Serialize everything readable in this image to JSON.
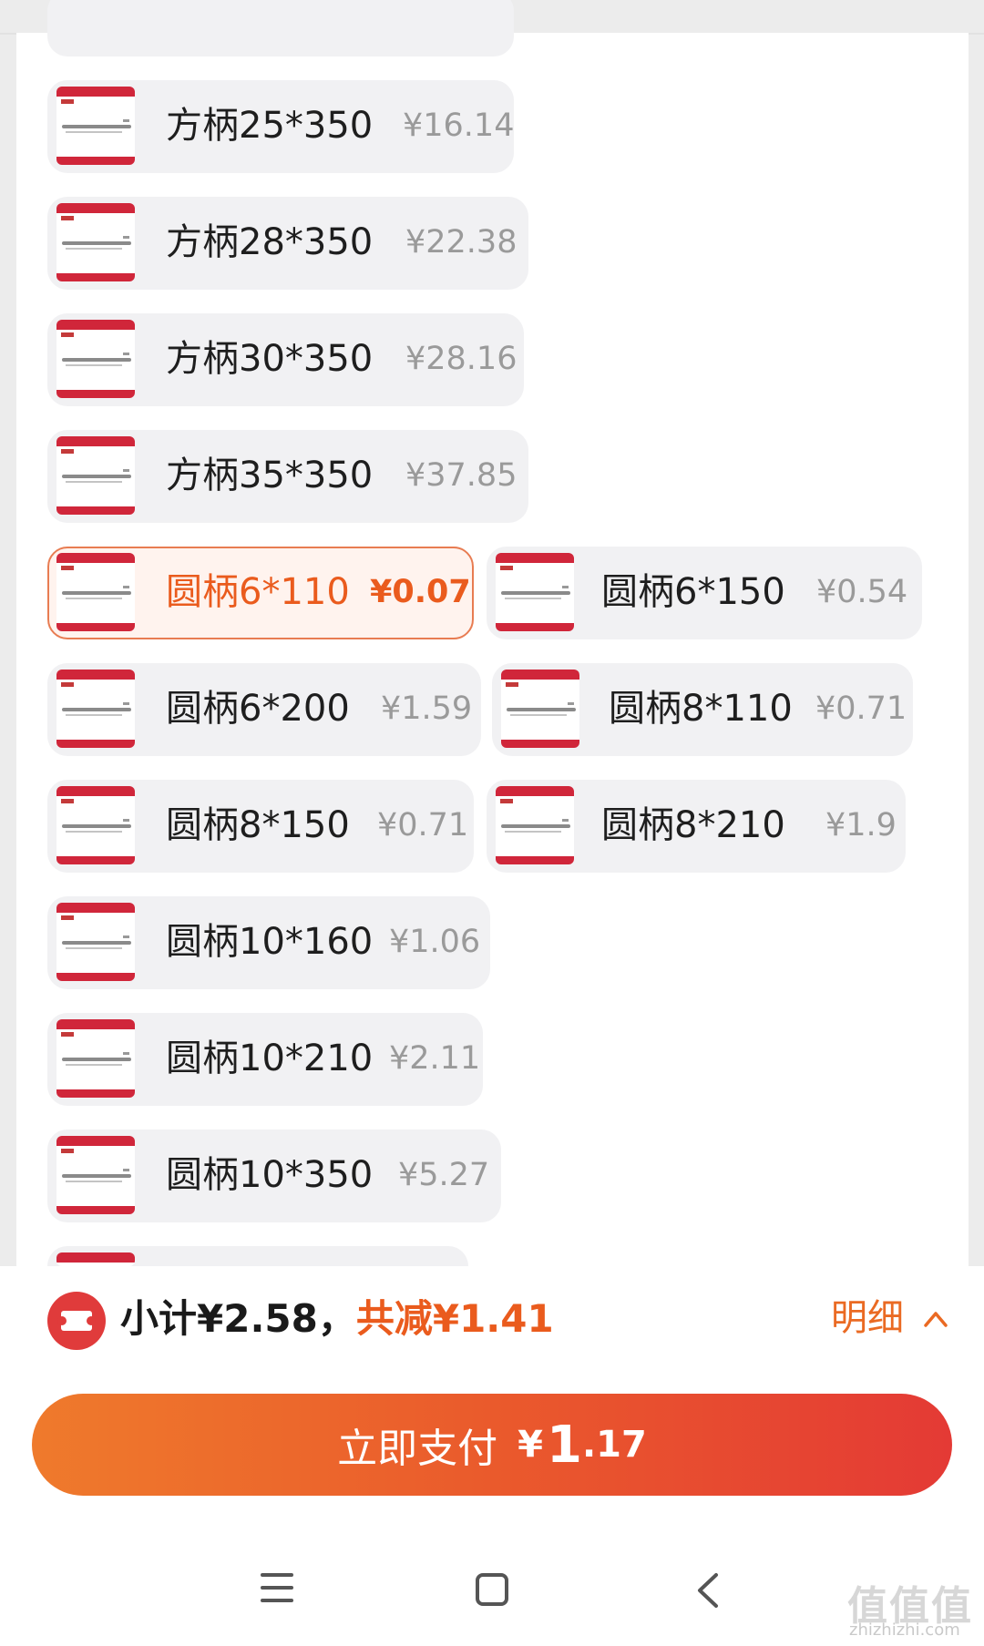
{
  "skus": [
    {
      "name": "方柄25*350",
      "price": "¥16.14"
    },
    {
      "name": "方柄28*350",
      "price": "¥22.38"
    },
    {
      "name": "方柄30*350",
      "price": "¥28.16"
    },
    {
      "name": "方柄35*350",
      "price": "¥37.85"
    },
    {
      "name": "圆柄6*110",
      "price": "¥0.07",
      "selected": true
    },
    {
      "name": "圆柄6*150",
      "price": "¥0.54"
    },
    {
      "name": "圆柄6*200",
      "price": "¥1.59"
    },
    {
      "name": "圆柄8*110",
      "price": "¥0.71"
    },
    {
      "name": "圆柄8*150",
      "price": "¥0.71"
    },
    {
      "name": "圆柄8*210",
      "price": "¥1.9"
    },
    {
      "name": "圆柄10*160",
      "price": "¥1.06"
    },
    {
      "name": "圆柄10*210",
      "price": "¥2.11"
    },
    {
      "name": "圆柄10*350",
      "price": "¥5.27"
    }
  ],
  "summary": {
    "subtotal": "小计¥2.58，",
    "discount": "共减¥1.41",
    "detail": "明细"
  },
  "pay": {
    "label": "立即支付",
    "yen": "¥",
    "integer": "1",
    "decimal": ".17"
  },
  "watermark": {
    "logo": "值值值",
    "url": "zhizhizhi.com"
  },
  "colors": {
    "accent": "#ea5b1d",
    "pay_gradient_start": "#ef7a2c",
    "pay_gradient_end": "#e43a35"
  }
}
